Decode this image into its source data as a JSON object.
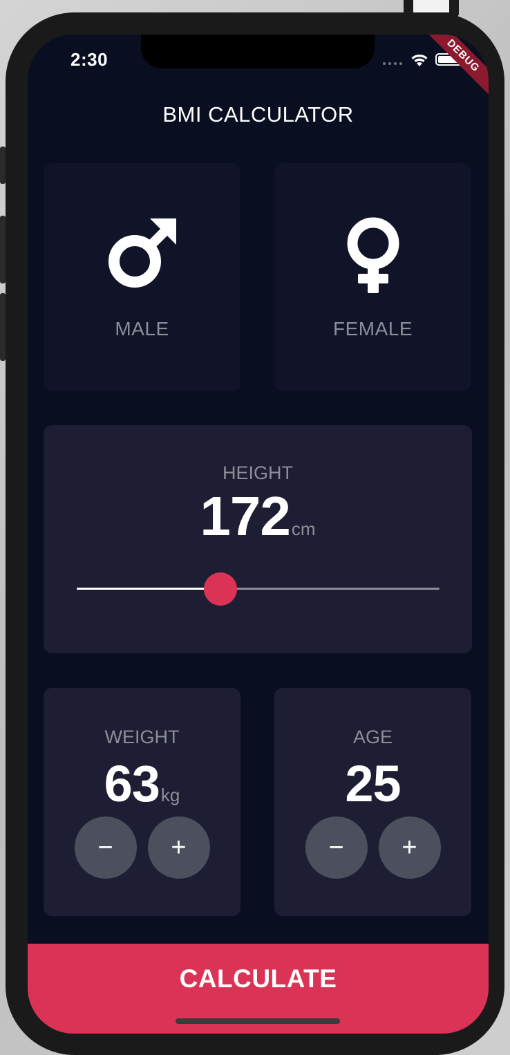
{
  "status_bar": {
    "time": "2:30",
    "debug_banner": "DEBUG"
  },
  "app": {
    "title": "BMI CALCULATOR"
  },
  "gender": {
    "male_label": "MALE",
    "female_label": "FEMALE",
    "male_icon": "mars-icon",
    "female_icon": "venus-icon"
  },
  "height": {
    "label": "HEIGHT",
    "value": "172",
    "unit": "cm",
    "slider_fraction": 0.397
  },
  "weight": {
    "label": "WEIGHT",
    "value": "63",
    "unit": "kg",
    "minus": "−",
    "plus": "+"
  },
  "age": {
    "label": "AGE",
    "value": "25",
    "minus": "−",
    "plus": "+"
  },
  "action": {
    "calculate_label": "CALCULATE"
  },
  "colors": {
    "background": "#0a0e21",
    "active_card": "#1d1e33",
    "inactive_card": "#111328",
    "accent": "#da3356",
    "button": "#4c4f5e",
    "muted_text": "#8d8e98"
  }
}
